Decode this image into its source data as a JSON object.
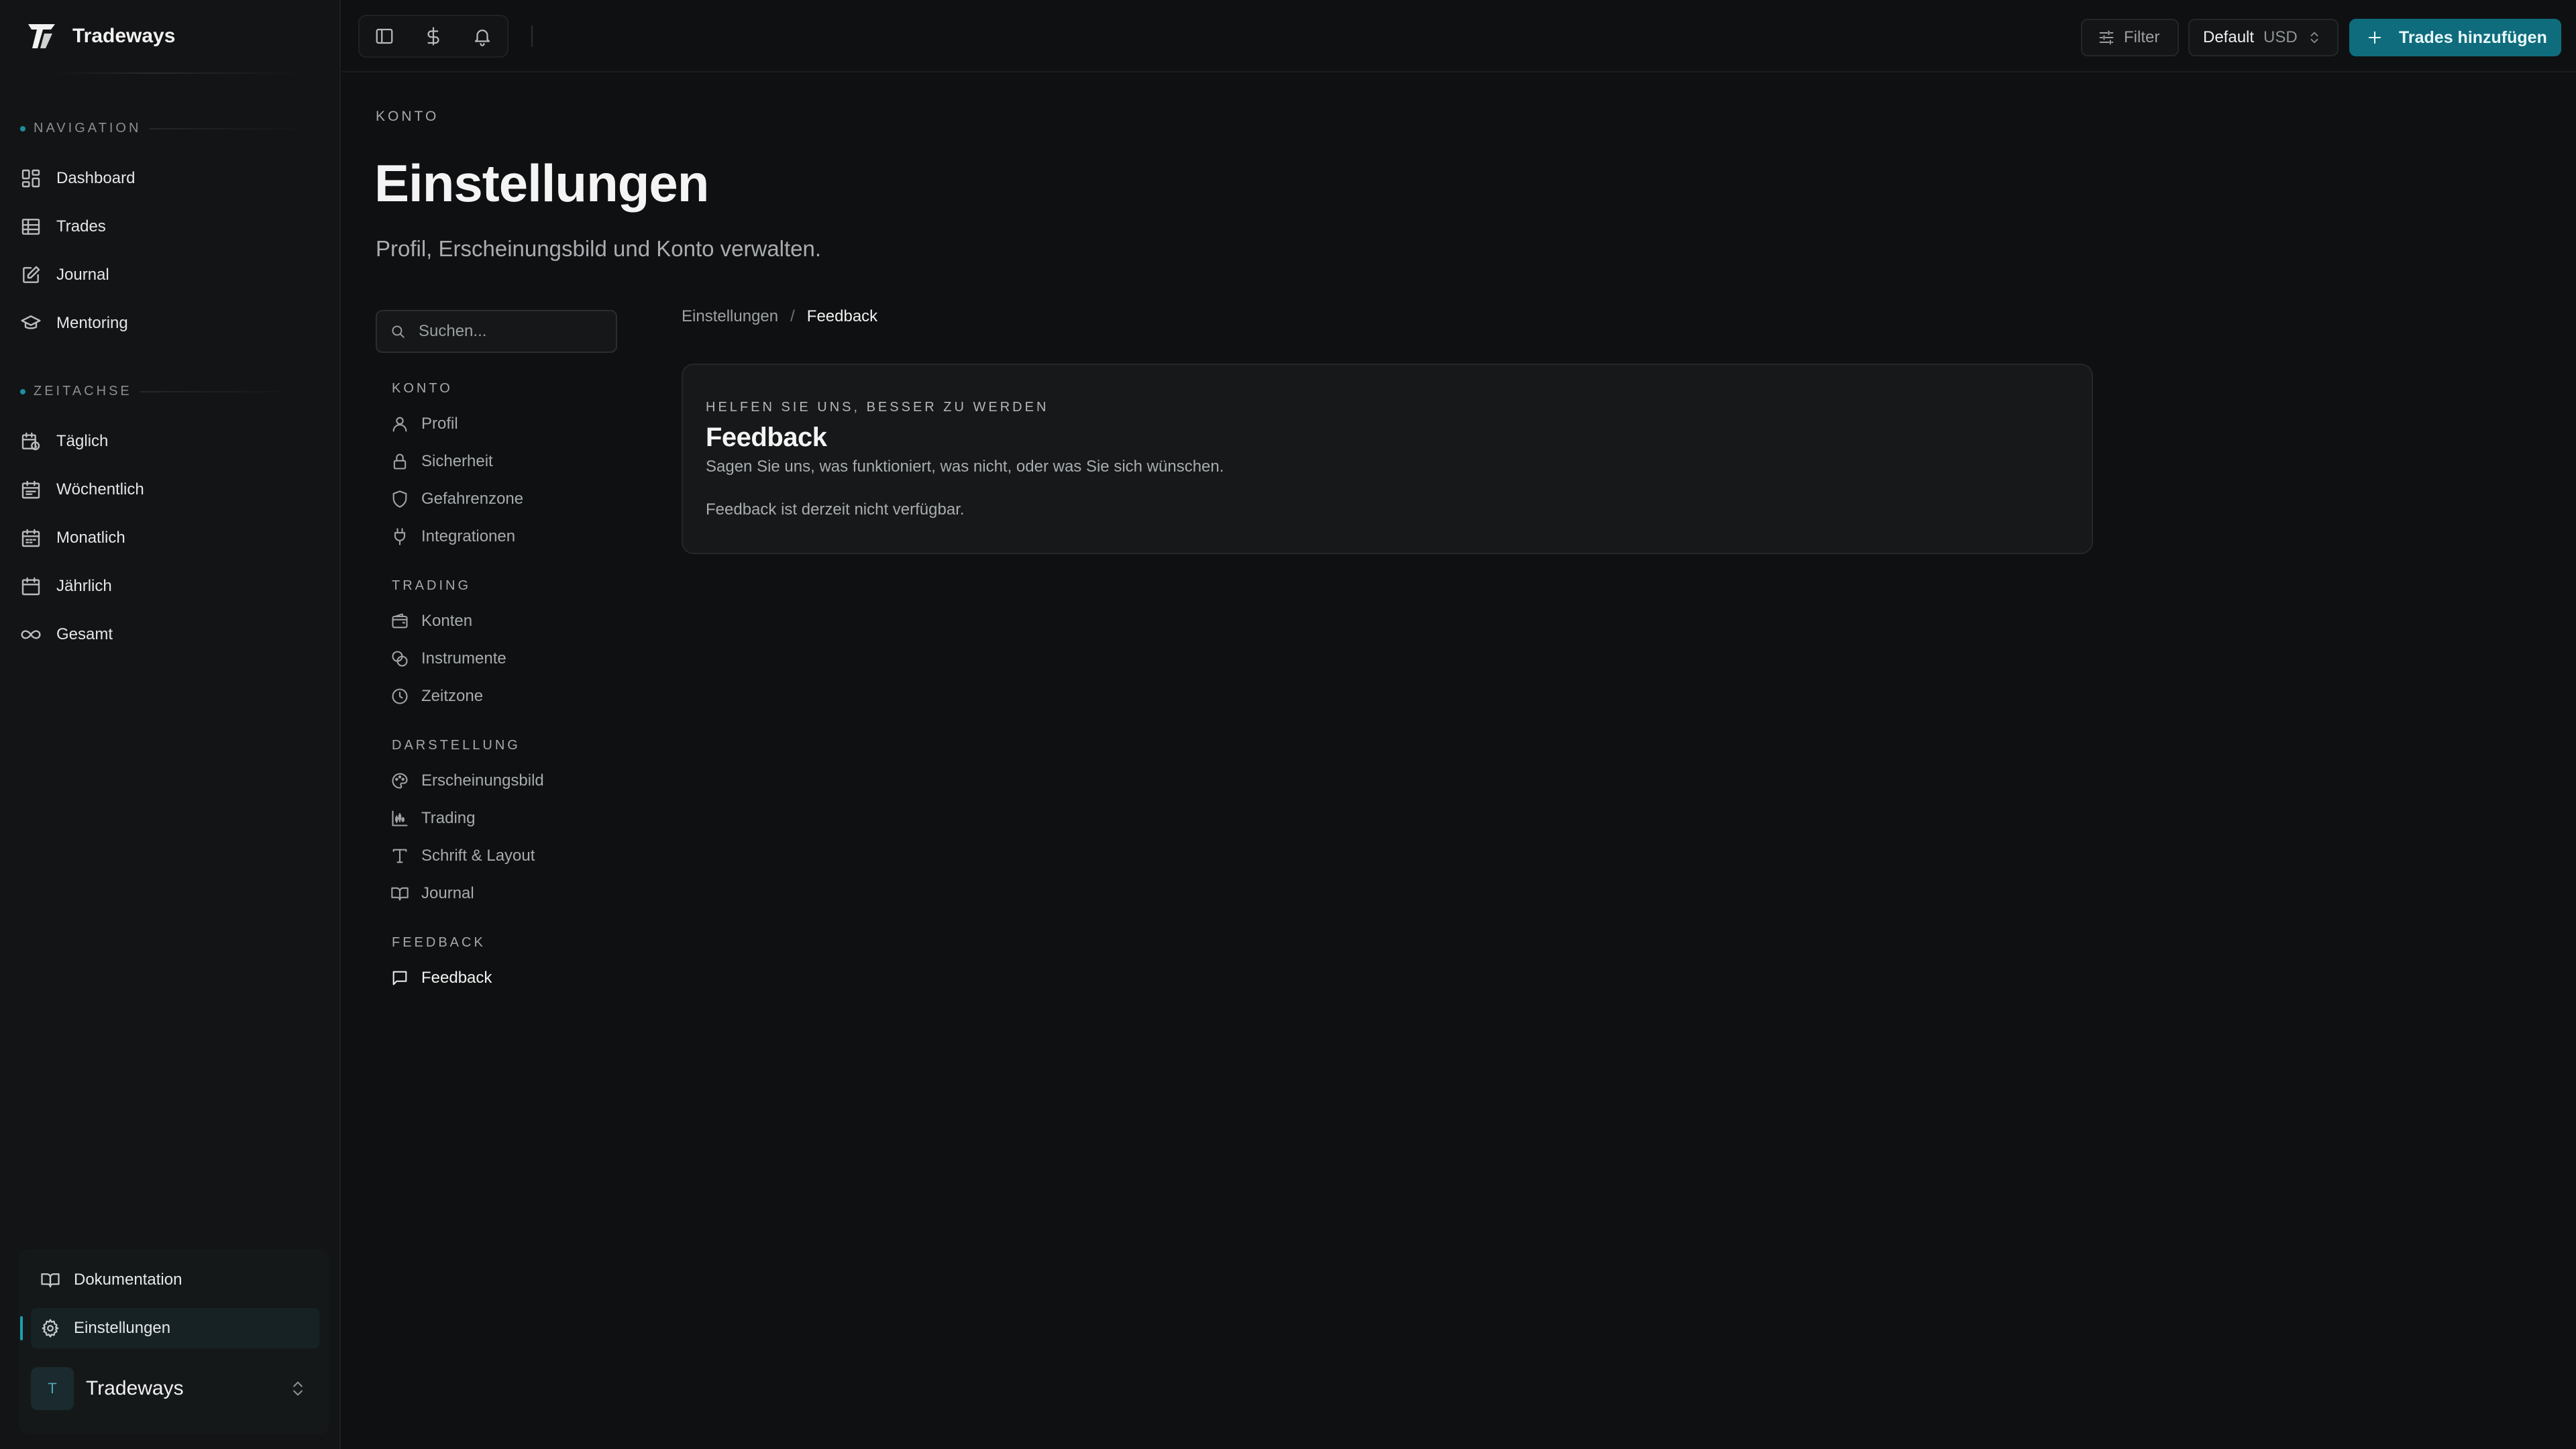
{
  "brand": {
    "name": "Tradeways"
  },
  "sidebar": {
    "navigation_label": "NAVIGATION",
    "nav": [
      {
        "label": "Dashboard",
        "icon": "dashboard-icon"
      },
      {
        "label": "Trades",
        "icon": "table-icon"
      },
      {
        "label": "Journal",
        "icon": "journal-edit-icon"
      },
      {
        "label": "Mentoring",
        "icon": "graduation-cap-icon"
      }
    ],
    "timeline_label": "ZEITACHSE",
    "timeline": [
      {
        "label": "Täglich",
        "icon": "calendar-clock-icon"
      },
      {
        "label": "Wöchentlich",
        "icon": "calendar-week-icon"
      },
      {
        "label": "Monatlich",
        "icon": "calendar-month-icon"
      },
      {
        "label": "Jährlich",
        "icon": "calendar-icon"
      },
      {
        "label": "Gesamt",
        "icon": "infinity-icon"
      }
    ],
    "bottom": [
      {
        "label": "Dokumentation",
        "icon": "book-icon"
      },
      {
        "label": "Einstellungen",
        "icon": "gear-icon"
      }
    ],
    "account": {
      "initial": "T",
      "name": "Tradeways"
    }
  },
  "topbar": {
    "filter_label": "Filter",
    "account_name": "Default",
    "currency": "USD",
    "add_label": "Trades hinzufügen"
  },
  "page": {
    "eyebrow": "KONTO",
    "title": "Einstellungen",
    "subtitle": "Profil, Erscheinungsbild und Konto verwalten."
  },
  "search": {
    "placeholder": "Suchen..."
  },
  "settings_nav": {
    "groups": [
      {
        "label": "KONTO",
        "items": [
          "Profil",
          "Sicherheit",
          "Gefahrenzone",
          "Integrationen"
        ]
      },
      {
        "label": "TRADING",
        "items": [
          "Konten",
          "Instrumente",
          "Zeitzone"
        ]
      },
      {
        "label": "DARSTELLUNG",
        "items": [
          "Erscheinungsbild",
          "Trading",
          "Schrift & Layout",
          "Journal"
        ]
      },
      {
        "label": "FEEDBACK",
        "items": [
          "Feedback"
        ]
      }
    ]
  },
  "breadcrumb": {
    "parent": "Einstellungen",
    "separator": "/",
    "current": "Feedback"
  },
  "card": {
    "eyebrow": "HELFEN SIE UNS, BESSER ZU WERDEN",
    "title": "Feedback",
    "description": "Sagen Sie uns, was funktioniert, was nicht, oder was Sie sich wünschen.",
    "note": "Feedback ist derzeit nicht verfügbar."
  },
  "colors": {
    "accent": "#0e6c7d",
    "active_bar": "#1b9fb2",
    "background": "#0f1011"
  }
}
